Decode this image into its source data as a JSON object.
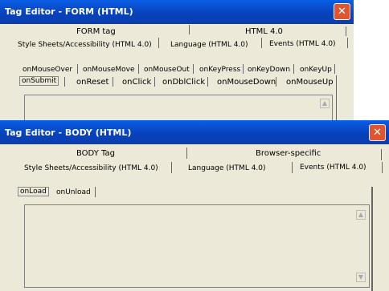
{
  "form_window": {
    "title": "Tag Editor - FORM  (HTML)",
    "close_glyph": "✕",
    "tabs_row1": [
      "FORM tag",
      "HTML 4.0"
    ],
    "tabs_row2": [
      "Style Sheets/Accessibility (HTML 4.0)",
      "Language (HTML 4.0)",
      "Events (HTML 4.0)"
    ],
    "event_tabs_row1": [
      "onMouseOver",
      "onMouseMove",
      "onMouseOut",
      "onKeyPress",
      "onKeyDown",
      "onKeyUp"
    ],
    "event_tabs_row2": [
      "onSubmit",
      "onReset",
      "onClick",
      "onDblClick",
      "onMouseDown",
      "onMouseUp"
    ],
    "selected_event": "onSubmit"
  },
  "body_window": {
    "title": "Tag Editor - BODY  (HTML)",
    "close_glyph": "✕",
    "tabs_row1": [
      "BODY Tag",
      "Browser-specific"
    ],
    "tabs_row2": [
      "Style Sheets/Accessibility (HTML 4.0)",
      "Language (HTML 4.0)",
      "Events (HTML 4.0)"
    ],
    "event_tabs": [
      "onLoad",
      "onUnload"
    ],
    "selected_event": "onLoad"
  },
  "colors": {
    "titlebar": "#0a5ee6",
    "close": "#e0552f",
    "dialog": "#ece9d8"
  }
}
